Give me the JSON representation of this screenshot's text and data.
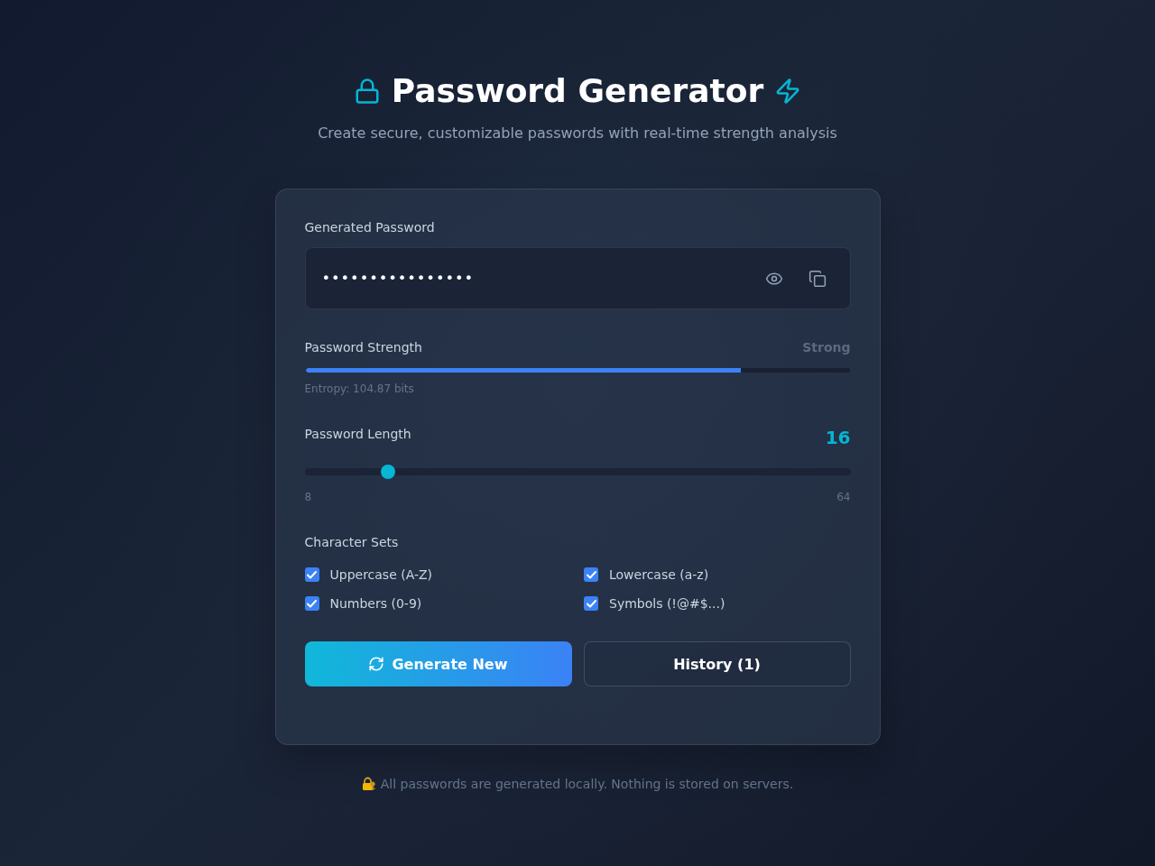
{
  "header": {
    "title": "Password Generator",
    "subtitle": "Create secure, customizable passwords with real-time strength analysis"
  },
  "password": {
    "label": "Generated Password",
    "value": "••••••••••••••••"
  },
  "strength": {
    "label": "Password Strength",
    "rating": "Strong",
    "level": 0.8,
    "entropy": "Entropy: 104.87 bits"
  },
  "length": {
    "label": "Password Length",
    "value": "16",
    "level": 0.143,
    "min": "8",
    "max": "64"
  },
  "character_sets": {
    "label": "Character Sets",
    "options": [
      {
        "label": "Uppercase (A-Z)",
        "checked": true
      },
      {
        "label": "Lowercase (a-z)",
        "checked": true
      },
      {
        "label": "Numbers (0-9)",
        "checked": true
      },
      {
        "label": "Symbols (!@#$...)",
        "checked": true
      }
    ]
  },
  "buttons": [
    {
      "label": "Generate New",
      "kind": "primary"
    },
    {
      "label": "History (1)",
      "kind": "secondary"
    }
  ],
  "footer": "All passwords are generated locally. Nothing is stored on servers."
}
